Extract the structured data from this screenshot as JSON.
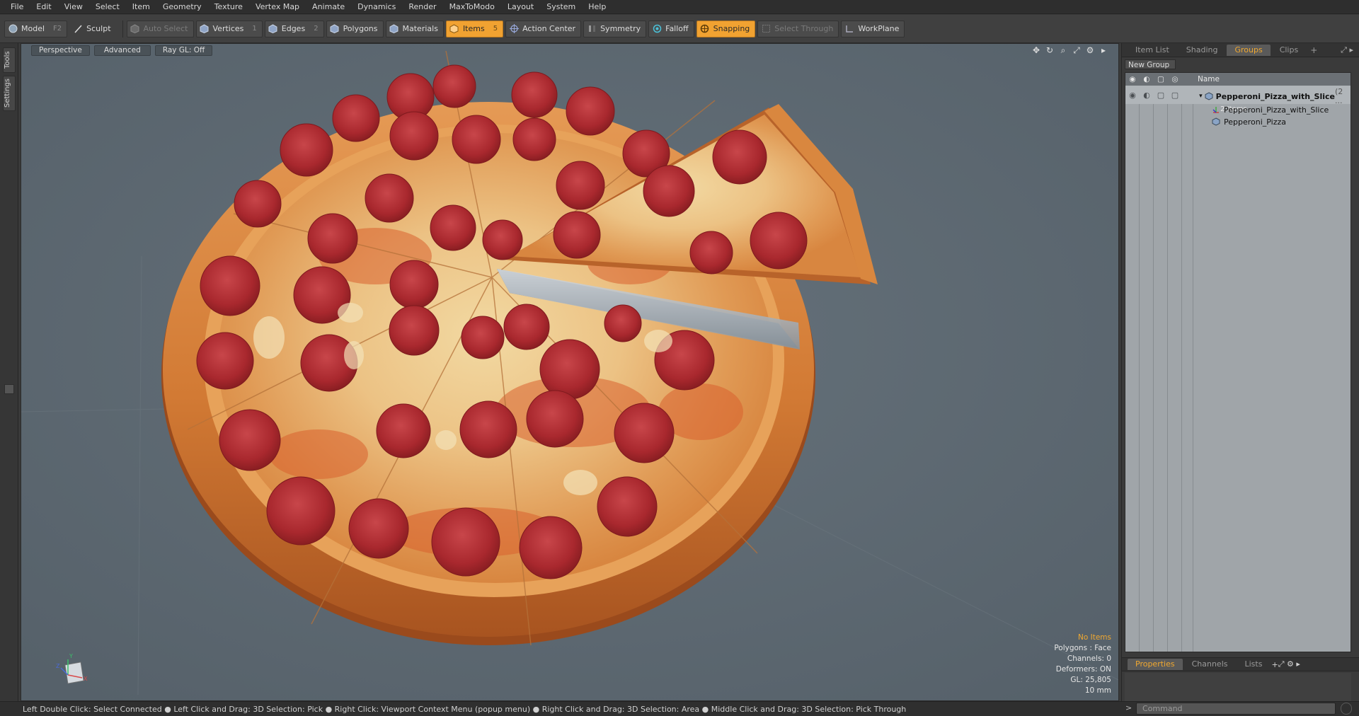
{
  "menu": [
    "File",
    "Edit",
    "View",
    "Select",
    "Item",
    "Geometry",
    "Texture",
    "Vertex Map",
    "Animate",
    "Dynamics",
    "Render",
    "MaxToModo",
    "Layout",
    "System",
    "Help"
  ],
  "toolbar": {
    "model": "Model",
    "model_key": "F2",
    "sculpt": "Sculpt",
    "auto_select": "Auto Select",
    "vertices": "Vertices",
    "vertices_key": "1",
    "edges": "Edges",
    "edges_key": "2",
    "polygons": "Polygons",
    "materials": "Materials",
    "items": "Items",
    "items_key": "5",
    "action_center": "Action Center",
    "symmetry": "Symmetry",
    "falloff": "Falloff",
    "snapping": "Snapping",
    "select_through": "Select Through",
    "workplane": "WorkPlane"
  },
  "left_tabs": [
    "Tools",
    "Settings"
  ],
  "viewport": {
    "view": "Perspective",
    "shading": "Advanced",
    "raygl": "Ray GL: Off",
    "info": {
      "selection": "No Items",
      "polygons": "Polygons : Face",
      "channels": "Channels: 0",
      "deformers": "Deformers: ON",
      "gl": "GL: 25,805",
      "unit": "10 mm"
    },
    "axes": {
      "z": "Z",
      "y": "Y",
      "x": "X"
    }
  },
  "panel": {
    "tabs": [
      "Item List",
      "Shading",
      "Groups",
      "Clips"
    ],
    "selected_tab": "Groups",
    "new_group": "New Group",
    "col_name": "Name",
    "tree": [
      {
        "label": "Pepperoni_Pizza_with_Slice",
        "suffix": " (2 ...",
        "sub": "2 Items"
      },
      {
        "label": "Pepperoni_Pizza_with_Slice"
      },
      {
        "label": "Pepperoni_Pizza"
      }
    ],
    "bottom_tabs": [
      "Properties",
      "Channels",
      "Lists"
    ],
    "bottom_selected": "Properties"
  },
  "status": "Left Double Click: Select Connected ● Left Click and Drag: 3D Selection: Pick ● Right Click: Viewport Context Menu (popup menu) ● Right Click and Drag: 3D Selection: Area ● Middle Click and Drag: 3D Selection: Pick Through",
  "command_placeholder": "Command",
  "colors": {
    "accent": "#f1a231",
    "viewport_bg": "#5d6972"
  }
}
